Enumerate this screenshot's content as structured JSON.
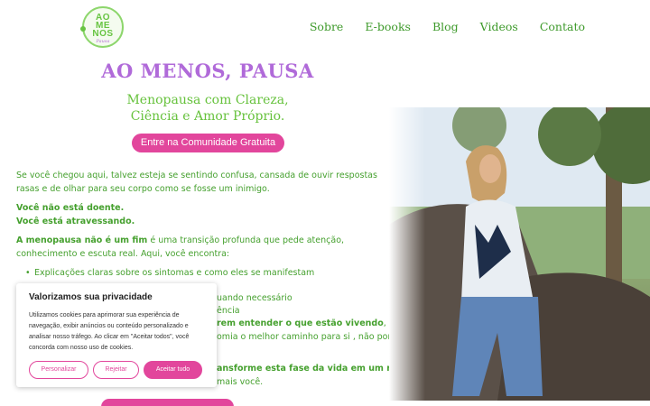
{
  "logo": {
    "text_lines": [
      "AO",
      "ME",
      "NOS"
    ],
    "subtext": "Pausa"
  },
  "nav": {
    "items": [
      "Sobre",
      "E-books",
      "Blog",
      "Videos",
      "Contato"
    ]
  },
  "hero": {
    "title": "AO MENOS, PAUSA",
    "tagline_line1": "Menopausa com Clareza,",
    "tagline_line2": "Ciência e Amor Próprio.",
    "cta_label": "Entre na Comunidade Gratuita"
  },
  "content": {
    "intro": "Se você chegou aqui, talvez esteja se sentindo confusa, cansada de ouvir respostas rasas e de olhar para seu corpo como se fosse um inimigo.",
    "not_sick": "Você não está doente.",
    "crossing": "Você está atravessando.",
    "menopause_bold": "A menopausa não é um fim",
    "menopause_rest": " é uma transição profunda que pede atenção, conhecimento e escuta real. Aqui, você encontra:",
    "bullet1": "Explicações claras sobre os sintomas e como eles se manifestam",
    "bullet2_tail": "uando necessário",
    "bullet3_tail": "ência",
    "line4_bold": "rem entender o que estão vivendo",
    "line4_end": ",",
    "line5_tail": "omia o melhor caminho para si , não por",
    "line6_bold": "ansforme esta fase da vida em um novo",
    "line7_tail": "mais você."
  },
  "cookie": {
    "title": "Valorizamos sua privacidade",
    "body": "Utilizamos cookies para aprimorar sua experiência de navegação, exibir anúncios ou conteúdo personalizado e analisar nosso tráfego. Ao clicar em \"Aceitar todos\", você concorda com nosso uso de cookies.",
    "customize_label": "Personalizar",
    "reject_label": "Rejeitar",
    "accept_label": "Aceitar tudo"
  },
  "colors": {
    "accent_pink": "#e2469c",
    "title_purple": "#b06ad9",
    "text_green": "#45a02e"
  }
}
